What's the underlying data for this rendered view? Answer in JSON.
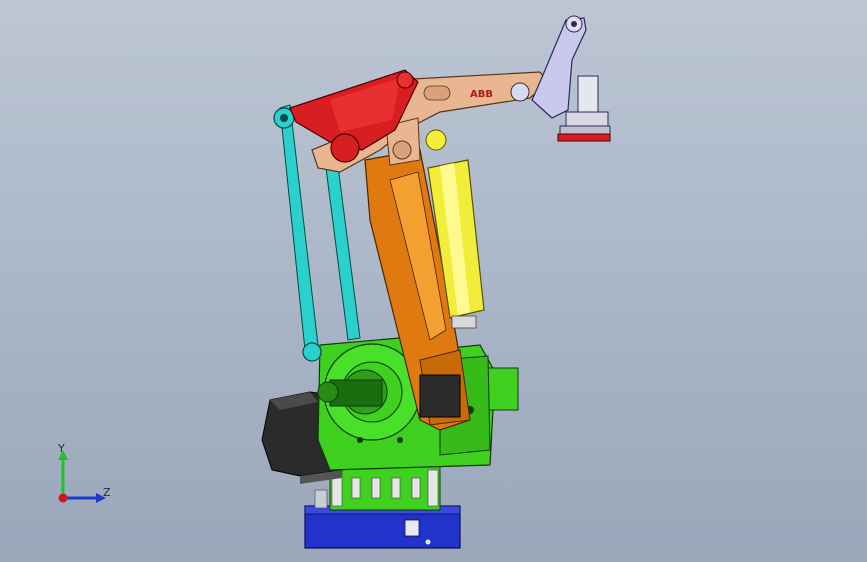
{
  "viewport": {
    "background_top": "#bcc6d4",
    "background_bottom": "#9aa7ba"
  },
  "model": {
    "brand_label": "ABB",
    "colors": {
      "arm_orange": "#e07a10",
      "arm_tan": "#e8b690",
      "counter_red": "#d81e20",
      "cylinder_yellow": "#f2ec3a",
      "base_green": "#3fd020",
      "link_cyan": "#2ad0cc",
      "motor_dark": "#2b2b2b",
      "foot_blue": "#2233cc",
      "tool_lavender": "#c9c8ee"
    }
  },
  "triad": {
    "y_label": "Y",
    "z_label": "Z",
    "y_color": "#22c030",
    "z_color": "#1a3ad0",
    "origin_color": "#d01818"
  }
}
